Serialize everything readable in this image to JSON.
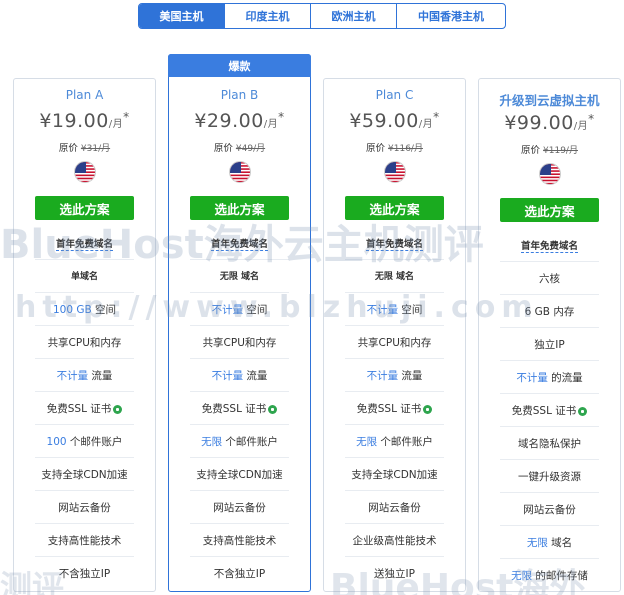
{
  "tabs": [
    "美国主机",
    "印度主机",
    "欧洲主机",
    "中国香港主机"
  ],
  "badge": "爆款",
  "select_label": "选此方案",
  "plans": [
    {
      "name": "Plan A",
      "price": "¥19.00",
      "unit": "/月",
      "star": "*",
      "orig_label": "原价",
      "orig_price": "¥31/月",
      "features": [
        "首年免费域名",
        "单域名",
        "100 GB 空间",
        "共享CPU和内存",
        "不计量 流量",
        "免费SSL 证书",
        "100 个邮件账户",
        "支持全球CDN加速",
        "网站云备份",
        "支持高性能技术",
        "不含独立IP"
      ]
    },
    {
      "name": "Plan B",
      "price": "¥29.00",
      "unit": "/月",
      "star": "*",
      "orig_label": "原价",
      "orig_price": "¥49/月",
      "features": [
        "首年免费域名",
        "无限 域名",
        "不计量 空间",
        "共享CPU和内存",
        "不计量 流量",
        "免费SSL 证书",
        "无限 个邮件账户",
        "支持全球CDN加速",
        "网站云备份",
        "支持高性能技术",
        "不含独立IP"
      ]
    },
    {
      "name": "Plan C",
      "price": "¥59.00",
      "unit": "/月",
      "star": "*",
      "orig_label": "原价",
      "orig_price": "¥116/月",
      "features": [
        "首年免费域名",
        "无限 域名",
        "不计量 空间",
        "共享CPU和内存",
        "不计量 流量",
        "免费SSL 证书",
        "无限 个邮件账户",
        "支持全球CDN加速",
        "网站云备份",
        "企业级高性能技术",
        "送独立IP"
      ]
    },
    {
      "name": "升级到云虚拟主机",
      "price": "¥99.00",
      "unit": "/月",
      "star": "*",
      "orig_label": "原价",
      "orig_price": "¥119/月",
      "features": [
        "首年免费域名",
        "六核",
        "6 GB 内存",
        "独立IP",
        "不计量 的流量",
        "免费SSL 证书",
        "域名隐私保护",
        "一键升级资源",
        "网站云备份",
        "无限 域名",
        "无限 的邮件存储"
      ]
    }
  ],
  "watermarks": {
    "line1": "BlueHost海外云主机测评",
    "line2": "http://www.blzhuji.com",
    "line3": "测评",
    "line4": "BlueHost海外"
  },
  "colors": {
    "primary": "#2f73d8",
    "button": "#1aab1f",
    "highlight": "#3a7de0"
  }
}
